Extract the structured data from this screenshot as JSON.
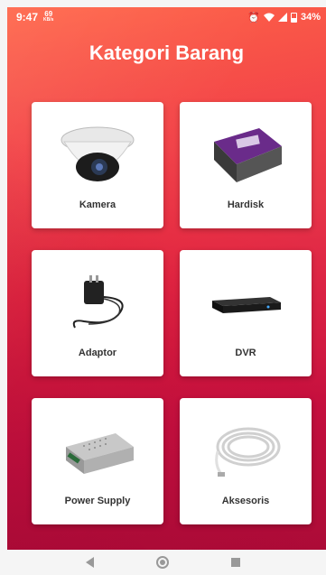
{
  "status_bar": {
    "time": "9:47",
    "net_speed_value": "69",
    "net_speed_unit": "KB/s",
    "battery": "34%",
    "icons": [
      "alarm-icon",
      "wifi-icon",
      "signal-icon",
      "battery-icon"
    ]
  },
  "title": "Kategori Barang",
  "categories": [
    {
      "label": "Kamera",
      "icon": "camera-icon"
    },
    {
      "label": "Hardisk",
      "icon": "hard-disk-icon"
    },
    {
      "label": "Adaptor",
      "icon": "adaptor-icon"
    },
    {
      "label": "DVR",
      "icon": "dvr-icon"
    },
    {
      "label": "Power Supply",
      "icon": "power-supply-icon"
    },
    {
      "label": "Aksesoris",
      "icon": "cable-icon"
    }
  ],
  "colors": {
    "background_top": "#ff5a3c",
    "background_bottom": "#b30c39",
    "card": "#ffffff"
  }
}
